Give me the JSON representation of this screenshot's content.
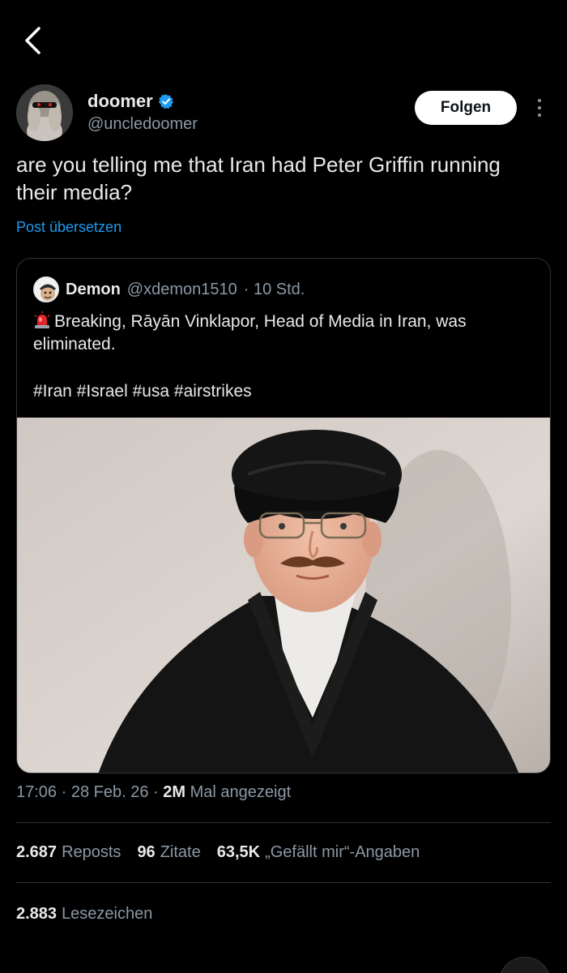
{
  "nav": {
    "back_icon": "chevron-left-icon"
  },
  "author": {
    "display_name": "doomer",
    "verified_icon": "verified-badge-icon",
    "verified_color": "#1d9bf0",
    "handle": "@uncledoomer",
    "follow_label": "Folgen"
  },
  "tweet": {
    "text": "are you telling me that Iran had Peter Griffin running their media?",
    "translate_label": "Post übersetzen"
  },
  "quote": {
    "name": "Demon",
    "handle": "@xdemon1510",
    "time": "· 10 Std.",
    "emoji_icon": "rotating-light-icon",
    "text": "Breaking, Rāyān Vinklapor, Head of Media in Iran, was eliminated.",
    "hashtags": "#Iran #Israel #usa #airstrikes"
  },
  "meta": {
    "time": "17:06",
    "date": "28 Feb. 26",
    "views_count": "2M",
    "views_label": "Mal angezeigt"
  },
  "stats": {
    "reposts_count": "2.687",
    "reposts_label": "Reposts",
    "quotes_count": "96",
    "quotes_label": "Zitate",
    "likes_count": "63,5K",
    "likes_label": "„Gefällt mir“-Angaben",
    "bookmarks_count": "2.883",
    "bookmarks_label": "Lesezeichen"
  },
  "colors": {
    "background": "#000000",
    "text_primary": "#e7e9ea",
    "text_secondary": "#8b98a5",
    "link": "#1d9bf0",
    "border": "#2f3336"
  }
}
